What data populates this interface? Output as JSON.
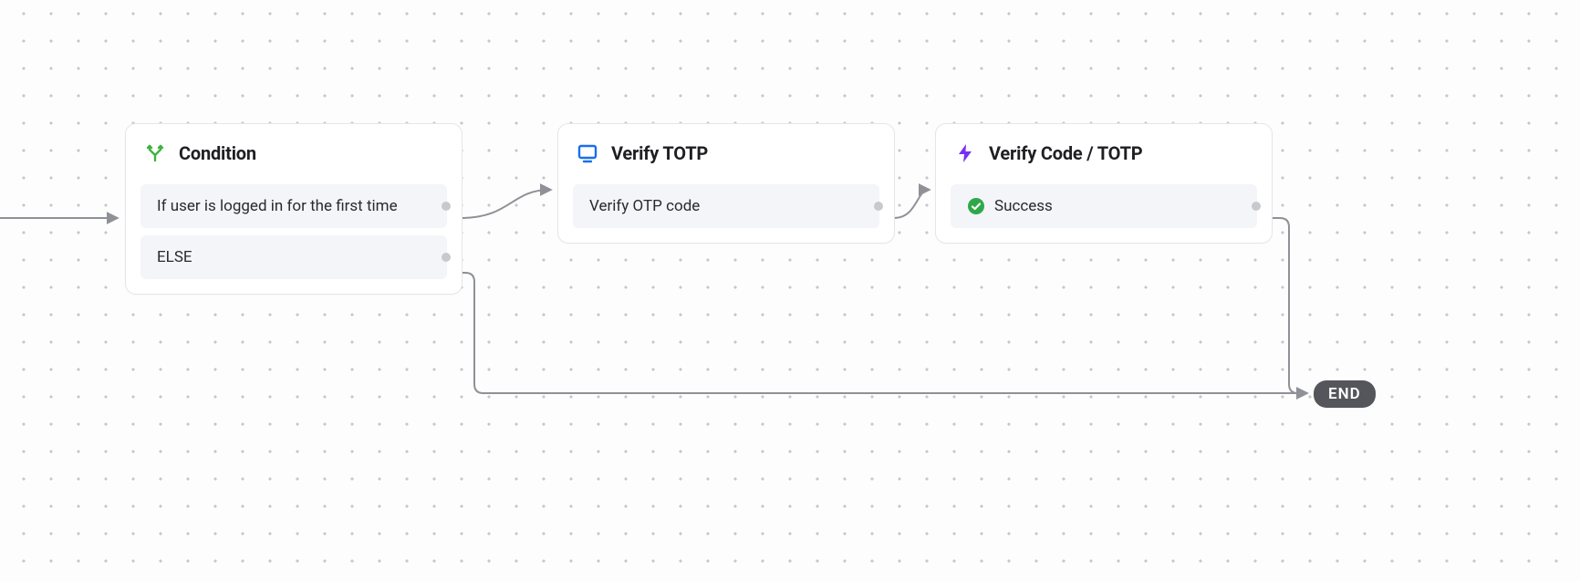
{
  "nodes": {
    "condition": {
      "title": "Condition",
      "rows": [
        "If user is logged in for the first time",
        "ELSE"
      ]
    },
    "verify_totp": {
      "title": "Verify TOTP",
      "rows": [
        "Verify OTP code"
      ]
    },
    "verify_code_totp": {
      "title": "Verify Code / TOTP",
      "rows": [
        "Success"
      ]
    }
  },
  "end_label": "END"
}
